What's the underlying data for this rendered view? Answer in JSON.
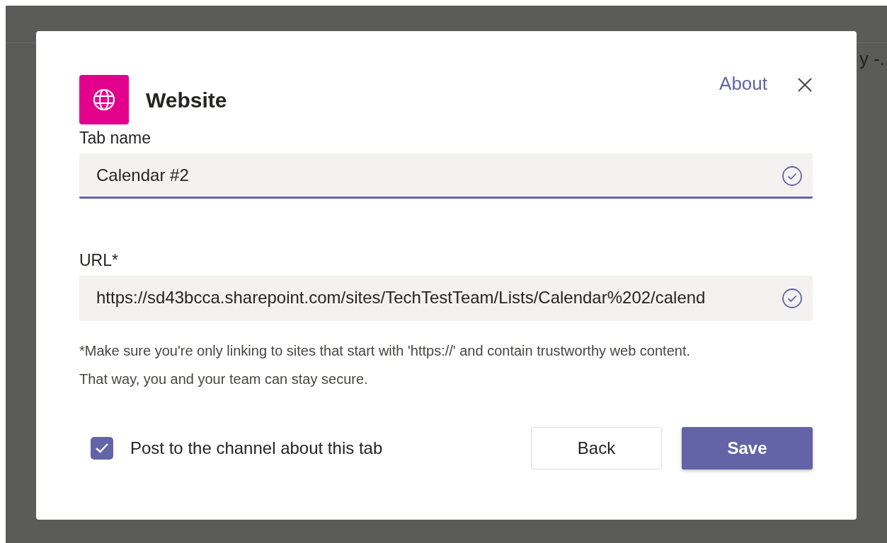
{
  "background": {
    "row_text": "y -."
  },
  "dialog": {
    "title": "Website",
    "about_link": "About",
    "fields": [
      {
        "label": "Tab name",
        "value": "Calendar #2",
        "focused": true,
        "valid": true
      },
      {
        "label": "URL*",
        "value": "https://sd43bcca.sharepoint.com/sites/TechTestTeam/Lists/Calendar%202/calend",
        "focused": false,
        "valid": true
      }
    ],
    "note": "*Make sure you're only linking to sites that start with 'https://' and contain trustworthy web content. That way, you and your team can stay secure.",
    "post_checkbox": {
      "label": "Post to the channel about this tab",
      "checked": true
    },
    "buttons": [
      {
        "label": "Back",
        "kind": "secondary"
      },
      {
        "label": "Save",
        "kind": "primary"
      }
    ]
  }
}
